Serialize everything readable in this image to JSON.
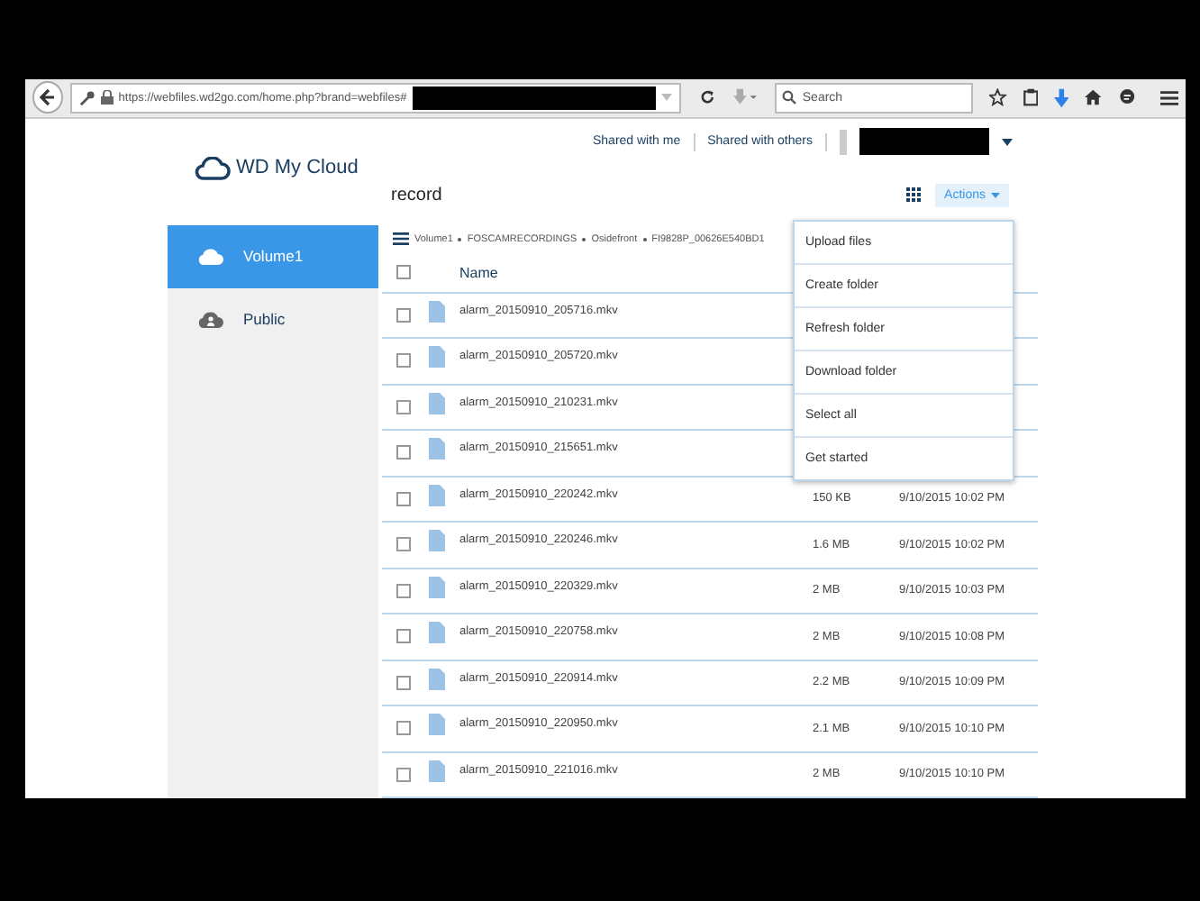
{
  "browser": {
    "url": "https://webfiles.wd2go.com/home.php?brand=webfiles#",
    "search": {
      "placeholder": "Search"
    }
  },
  "header": {
    "logo": "WD My Cloud",
    "links": [
      "Shared with me",
      "Shared with others"
    ]
  },
  "sidebar": {
    "items": [
      {
        "label": "Volume1",
        "selected": true,
        "kind": "cloud"
      },
      {
        "label": "Public",
        "selected": false,
        "kind": "people"
      }
    ]
  },
  "folder": {
    "title": "record",
    "actions": "Actions",
    "breadcrumb": [
      "Volume1",
      "FOSCAMRECORDINGS",
      "Osidefront",
      "FI9828P_00626E540BD1"
    ]
  },
  "table": {
    "columns": [
      "Name"
    ],
    "all_checked": false,
    "rows": [
      {
        "name": "alarm_20150910_205716.mkv",
        "checked": false
      },
      {
        "name": "alarm_20150910_205720.mkv",
        "checked": false
      },
      {
        "name": "alarm_20150910_210231.mkv",
        "checked": false
      },
      {
        "name": "alarm_20150910_215651.mkv",
        "checked": false
      },
      {
        "name": "alarm_20150910_220242.mkv",
        "checked": false,
        "size": "150 KB",
        "date": "9/10/2015 10:02 PM"
      },
      {
        "name": "alarm_20150910_220246.mkv",
        "checked": false,
        "size": "1.6 MB",
        "date": "9/10/2015 10:02 PM"
      },
      {
        "name": "alarm_20150910_220329.mkv",
        "checked": false,
        "size": "2 MB",
        "date": "9/10/2015 10:03 PM"
      },
      {
        "name": "alarm_20150910_220758.mkv",
        "checked": false,
        "size": "2 MB",
        "date": "9/10/2015 10:08 PM"
      },
      {
        "name": "alarm_20150910_220914.mkv",
        "checked": false,
        "size": "2.2 MB",
        "date": "9/10/2015 10:09 PM"
      },
      {
        "name": "alarm_20150910_220950.mkv",
        "checked": false,
        "size": "2.1 MB",
        "date": "9/10/2015 10:10 PM"
      },
      {
        "name": "alarm_20150910_221016.mkv",
        "checked": false,
        "size": "2 MB",
        "date": "9/10/2015 10:10 PM"
      }
    ]
  },
  "actions_menu": {
    "items": [
      "Upload files",
      "Create folder",
      "Refresh folder",
      "Download folder",
      "Select all",
      "Get started"
    ]
  }
}
